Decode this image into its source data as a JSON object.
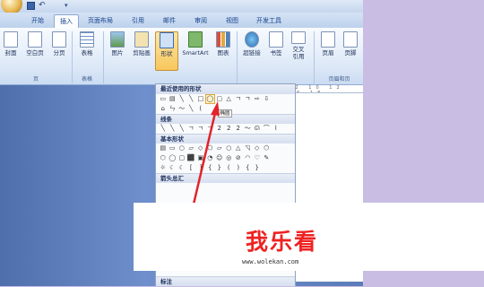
{
  "quick_access": {
    "undo_glyph": "↶",
    "more_glyph": "▾"
  },
  "tabs": [
    "开始",
    "插入",
    "页面布局",
    "引用",
    "邮件",
    "审阅",
    "视图",
    "开发工具"
  ],
  "active_tab": "插入",
  "ribbon": {
    "buttons": [
      "封面",
      "空白页",
      "分页",
      "表格",
      "图片",
      "剪贴画",
      "形状",
      "SmartArt",
      "图表",
      "超链接",
      "书签",
      "交叉\n引用",
      "页眉",
      "页脚"
    ],
    "groups": [
      "页",
      "表格",
      "页眉和页"
    ]
  },
  "ruler_text": "6 4 2 10 12 14 16 18",
  "dropdown": {
    "sections": [
      "最近使用的形状",
      "线条",
      "基本形状",
      "箭头总汇",
      "标注"
    ],
    "recent_row1": [
      "▭",
      "▤",
      "╲",
      "╲",
      "□",
      "◯",
      "▢",
      "△",
      "ㄱ",
      "ㄱ",
      "⇨",
      "⇩"
    ],
    "recent_row2": [
      "⌂",
      "ㄣ",
      "〜",
      "╲",
      "("
    ],
    "lines_row": [
      "╲",
      "╲",
      "╲",
      "ㄱ",
      "ㄱ",
      "ㄱ",
      "2",
      "2",
      "2",
      "〜",
      "ᘏ",
      "⌒",
      "⌇"
    ],
    "basic_row1": [
      "▤",
      "▭",
      "○",
      "▱",
      "◇",
      "⬠",
      "▱",
      "○",
      "△",
      "◹",
      "◇",
      "⬡"
    ],
    "basic_row2": [
      "⬡",
      "◯",
      "▢",
      "⬛",
      "▣",
      "◔",
      "☺",
      "◎",
      "⊘",
      "◠",
      "♡",
      "✎"
    ],
    "basic_row3": [
      "☼",
      "☾",
      "☾",
      "[",
      "]",
      "{",
      "}",
      "(",
      ")",
      "{",
      "}"
    ],
    "tooltip": "椭圆"
  },
  "watermark": {
    "title": "我乐看",
    "url": "www.wolekan.com"
  },
  "colors": {
    "accent": "#ee2222",
    "ribbon_blue": "#15428b",
    "active_highlight": "#f7c75b"
  }
}
